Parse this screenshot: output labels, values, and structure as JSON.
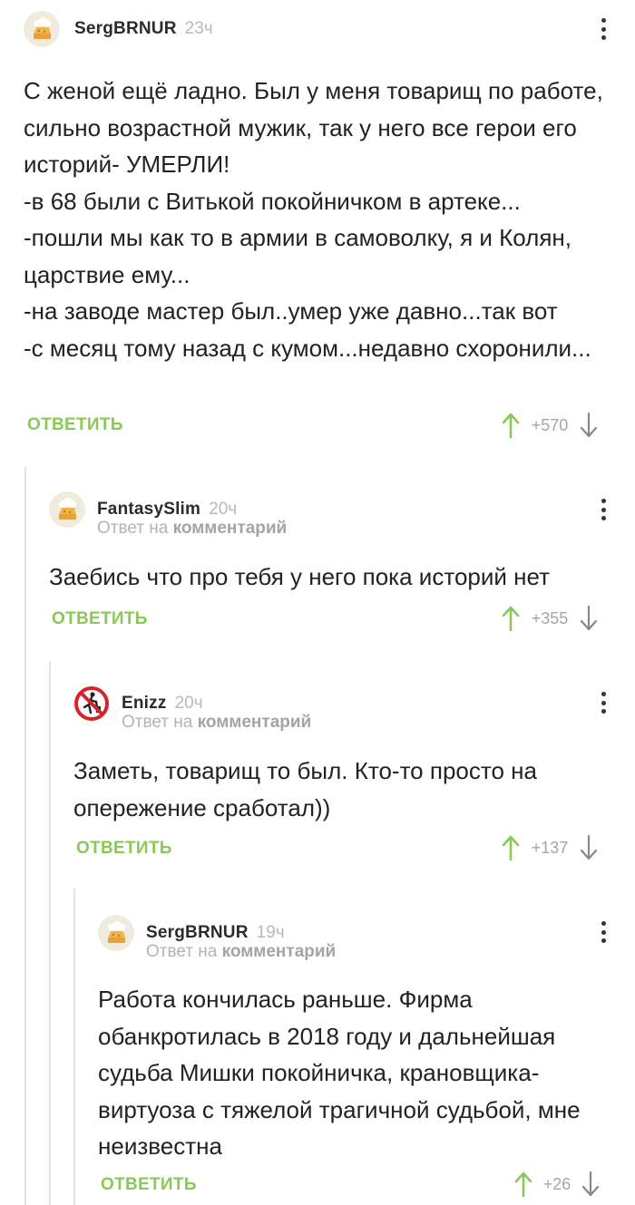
{
  "comments": [
    {
      "username": "SergBRNUR",
      "time": "23ч",
      "avatar_icon": "cake-avatar-icon",
      "text": "С женой ещё ладно. Был у меня товарищ по работе, сильно возрастной мужик, так у него все герои его историй- УМЕРЛИ!\n-в 68 были с Витькой покойничком в артеке...\n-пошли мы как то в армии в самоволку, я и Колян, царствие ему...\n-на заводе мастер был..умер уже давно...так вот\n-с месяц тому назад с кумом...недавно схоронили...",
      "reply_label": "ОТВЕТИТЬ",
      "score": "+570"
    },
    {
      "username": "FantasySlim",
      "time": "20ч",
      "avatar_icon": "cake-avatar-icon",
      "reply_prefix": "Ответ на",
      "reply_target": "комментарий",
      "text": "Заебись что про тебя у него пока историй нет",
      "reply_label": "ОТВЕТИТЬ",
      "score": "+355"
    },
    {
      "username": "Enizz",
      "time": "20ч",
      "avatar_icon": "no-littering-sign-avatar-icon",
      "reply_prefix": "Ответ на",
      "reply_target": "комментарий",
      "text": "Заметь, товарищ то был. Кто-то просто на опережение сработал))",
      "reply_label": "ОТВЕТИТЬ",
      "score": "+137"
    },
    {
      "username": "SergBRNUR",
      "time": "19ч",
      "avatar_icon": "cake-avatar-icon",
      "reply_prefix": "Ответ на",
      "reply_target": "комментарий",
      "text": "Работа кончилась раньше. Фирма обанкротилась в 2018 году и дальнейшая судьба Мишки покойничка, крановщика-виртуоза с тяжелой трагичной судьбой, мне неизвестна",
      "reply_label": "ОТВЕТИТЬ",
      "score": "+26"
    }
  ],
  "colors": {
    "accent_green": "#8ac858",
    "username": "#2b2b2b",
    "muted": "#b3b3b3",
    "thread_line": "#e4e4e4"
  }
}
